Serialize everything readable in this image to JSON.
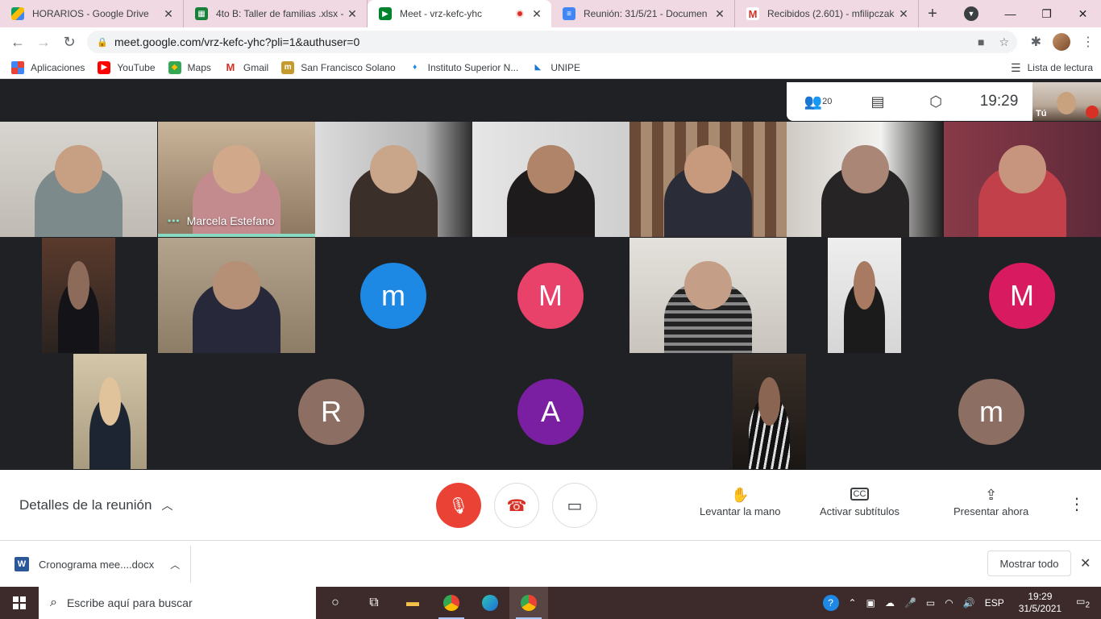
{
  "tabs": [
    {
      "title": "HORARIOS - Google Drive",
      "icon": "google-drive-icon",
      "color": "#1a73e8"
    },
    {
      "title": "4to B: Taller de familias .xlsx -",
      "icon": "sheets-icon",
      "color": "#188038"
    },
    {
      "title": "Meet - vrz-kefc-yhc",
      "icon": "meet-icon",
      "color": "#00832d"
    },
    {
      "title": "Reunión: 31/5/21 - Documen",
      "icon": "docs-icon",
      "color": "#4285f4"
    },
    {
      "title": "Recibidos (2.601) - mfilipczak",
      "icon": "gmail-icon",
      "color": "#d93025"
    }
  ],
  "address": {
    "url": "meet.google.com/vrz-kefc-yhc?pli=1&authuser=0"
  },
  "bookmarks": [
    {
      "label": "Aplicaciones",
      "icon": "apps-grid-icon"
    },
    {
      "label": "YouTube",
      "icon": "youtube-icon"
    },
    {
      "label": "Maps",
      "icon": "maps-icon"
    },
    {
      "label": "Gmail",
      "icon": "gmail-icon"
    },
    {
      "label": "San Francisco Solano",
      "icon": "site-icon"
    },
    {
      "label": "Instituto Superior N...",
      "icon": "site-icon"
    },
    {
      "label": "UNIPE",
      "icon": "site-icon"
    }
  ],
  "reading_list": "Lista de lectura",
  "meet": {
    "participant_count": "20",
    "time": "19:29",
    "self_label": "Tú",
    "speaker_name": "Marcela Estefano",
    "letter_tiles": [
      {
        "letter": "m",
        "color": "#1e88e5"
      },
      {
        "letter": "M",
        "color": "#e8416a"
      },
      {
        "letter": "M",
        "color": "#d81b60"
      },
      {
        "letter": "R",
        "color": "#8d6e63"
      },
      {
        "letter": "A",
        "color": "#7b1fa2"
      },
      {
        "letter": "m",
        "color": "#8d6e63"
      }
    ]
  },
  "controls": {
    "details": "Detalles de la reunión",
    "raise_hand": "Levantar la mano",
    "captions": "Activar subtítulos",
    "present": "Presentar ahora"
  },
  "downloads": {
    "file": "Cronograma mee....docx",
    "show_all": "Mostrar todo"
  },
  "taskbar": {
    "search_placeholder": "Escribe aquí para buscar",
    "lang": "ESP",
    "time": "19:29",
    "date": "31/5/2021",
    "notifications": "2"
  }
}
